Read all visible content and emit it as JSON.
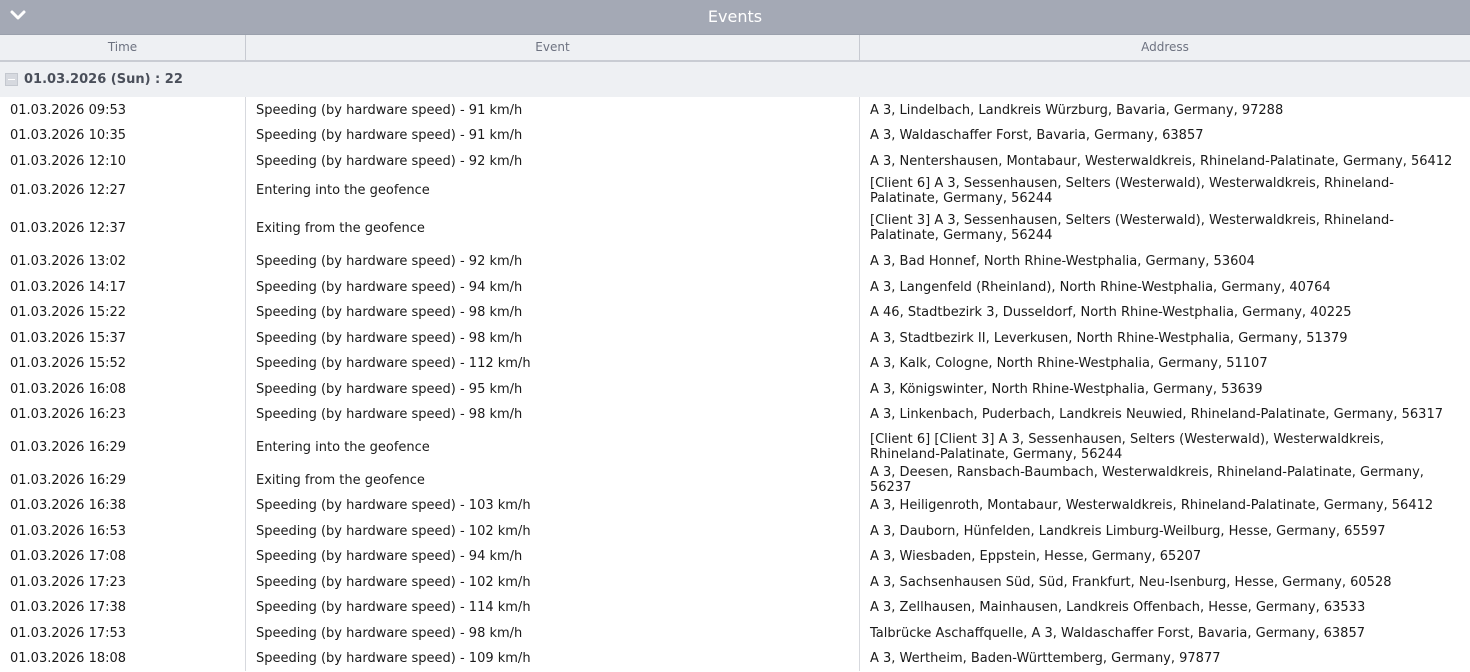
{
  "panel": {
    "title": "Events",
    "collapse_icon": "chevron-down-icon"
  },
  "columns": {
    "time": "Time",
    "event": "Event",
    "address": "Address"
  },
  "group": {
    "label": "01.03.2026 (Sun) : 22"
  },
  "rows": [
    {
      "time": "01.03.2026 09:53",
      "event": "Speeding (by hardware speed) - 91 km/h",
      "address": "A 3, Lindelbach, Landkreis Würzburg, Bavaria, Germany, 97288"
    },
    {
      "time": "01.03.2026 10:35",
      "event": "Speeding (by hardware speed) - 91 km/h",
      "address": "A 3, Waldaschaffer Forst, Bavaria, Germany, 63857"
    },
    {
      "time": "01.03.2026 12:10",
      "event": "Speeding (by hardware speed) - 92 km/h",
      "address": "A 3, Nentershausen, Montabaur, Westerwaldkreis, Rhineland-Palatinate, Germany, 56412"
    },
    {
      "time": "01.03.2026 12:27",
      "event": "Entering into the geofence",
      "address": "[Client 6] A 3, Sessenhausen, Selters (Westerwald), Westerwaldkreis, Rhineland-Palatinate, Germany, 56244"
    },
    {
      "time": "01.03.2026 12:37",
      "event": "Exiting from the geofence",
      "address": "[Client 3] A 3, Sessenhausen, Selters (Westerwald), Westerwaldkreis, Rhineland-Palatinate, Germany, 56244"
    },
    {
      "time": "01.03.2026 13:02",
      "event": "Speeding (by hardware speed) - 92 km/h",
      "address": "A 3, Bad Honnef, North Rhine-Westphalia, Germany, 53604"
    },
    {
      "time": "01.03.2026 14:17",
      "event": "Speeding (by hardware speed) - 94 km/h",
      "address": "A 3, Langenfeld (Rheinland), North Rhine-Westphalia, Germany, 40764"
    },
    {
      "time": "01.03.2026 15:22",
      "event": "Speeding (by hardware speed) - 98 km/h",
      "address": "A 46, Stadtbezirk 3, Dusseldorf, North Rhine-Westphalia, Germany, 40225"
    },
    {
      "time": "01.03.2026 15:37",
      "event": "Speeding (by hardware speed) - 98 km/h",
      "address": "A 3, Stadtbezirk II, Leverkusen, North Rhine-Westphalia, Germany, 51379"
    },
    {
      "time": "01.03.2026 15:52",
      "event": "Speeding (by hardware speed) - 112 km/h",
      "address": "A 3, Kalk, Cologne, North Rhine-Westphalia, Germany, 51107"
    },
    {
      "time": "01.03.2026 16:08",
      "event": "Speeding (by hardware speed) - 95 km/h",
      "address": "A 3, Königswinter, North Rhine-Westphalia, Germany, 53639"
    },
    {
      "time": "01.03.2026 16:23",
      "event": "Speeding (by hardware speed) - 98 km/h",
      "address": "A 3, Linkenbach, Puderbach, Landkreis Neuwied, Rhineland-Palatinate, Germany, 56317"
    },
    {
      "time": "01.03.2026 16:29",
      "event": "Entering into the geofence",
      "address": "[Client 6] [Client 3] A 3, Sessenhausen, Selters (Westerwald), Westerwaldkreis, Rhineland-Palatinate, Germany, 56244"
    },
    {
      "time": "01.03.2026 16:29",
      "event": "Exiting from the geofence",
      "address": "A 3, Deesen, Ransbach-Baumbach, Westerwaldkreis, Rhineland-Palatinate, Germany, 56237"
    },
    {
      "time": "01.03.2026 16:38",
      "event": "Speeding (by hardware speed) - 103 km/h",
      "address": "A 3, Heiligenroth, Montabaur, Westerwaldkreis, Rhineland-Palatinate, Germany, 56412"
    },
    {
      "time": "01.03.2026 16:53",
      "event": "Speeding (by hardware speed) - 102 km/h",
      "address": "A 3, Dauborn, Hünfelden, Landkreis Limburg-Weilburg, Hesse, Germany, 65597"
    },
    {
      "time": "01.03.2026 17:08",
      "event": "Speeding (by hardware speed) - 94 km/h",
      "address": "A 3, Wiesbaden, Eppstein, Hesse, Germany, 65207"
    },
    {
      "time": "01.03.2026 17:23",
      "event": "Speeding (by hardware speed) - 102 km/h",
      "address": "A 3, Sachsenhausen Süd, Süd, Frankfurt, Neu-Isenburg, Hesse, Germany, 60528"
    },
    {
      "time": "01.03.2026 17:38",
      "event": "Speeding (by hardware speed) - 114 km/h",
      "address": "A 3, Zellhausen, Mainhausen, Landkreis Offenbach, Hesse, Germany, 63533"
    },
    {
      "time": "01.03.2026 17:53",
      "event": "Speeding (by hardware speed) - 98 km/h",
      "address": "Talbrücke Aschaffquelle, A 3, Waldaschaffer Forst, Bavaria, Germany, 63857"
    },
    {
      "time": "01.03.2026 18:08",
      "event": "Speeding (by hardware speed) - 109 km/h",
      "address": "A 3, Wertheim, Baden-Württemberg, Germany, 97877"
    }
  ]
}
